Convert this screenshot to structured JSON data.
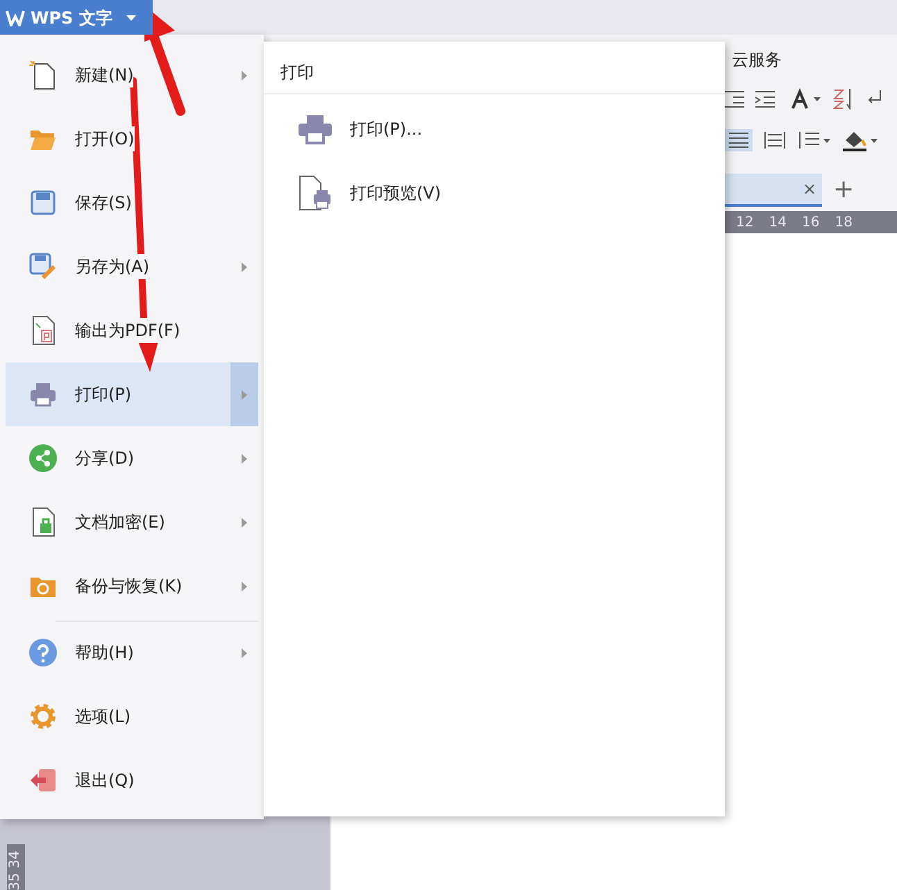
{
  "app_button": {
    "label": "WPS 文字"
  },
  "ribbon": {
    "tab": "云服务"
  },
  "document_tab": {
    "close": "×"
  },
  "new_tab": "+",
  "ruler": {
    "marks": [
      "12",
      "14",
      "16",
      "18"
    ]
  },
  "vertical_ruler": {
    "marks": [
      "34",
      "35"
    ]
  },
  "menu": {
    "items": [
      {
        "label": "新建(N)",
        "submenu": true,
        "selected": false,
        "separator_before": false
      },
      {
        "label": "打开(O)",
        "submenu": false,
        "selected": false,
        "separator_before": false
      },
      {
        "label": "保存(S)",
        "submenu": false,
        "selected": false,
        "separator_before": false
      },
      {
        "label": "另存为(A)",
        "submenu": true,
        "selected": false,
        "separator_before": false
      },
      {
        "label": "输出为PDF(F)",
        "submenu": false,
        "selected": false,
        "separator_before": false
      },
      {
        "label": "打印(P)",
        "submenu": true,
        "selected": true,
        "separator_before": false
      },
      {
        "label": "分享(D)",
        "submenu": true,
        "selected": false,
        "separator_before": false
      },
      {
        "label": "文档加密(E)",
        "submenu": true,
        "selected": false,
        "separator_before": false
      },
      {
        "label": "备份与恢复(K)",
        "submenu": true,
        "selected": false,
        "separator_before": false
      },
      {
        "label": "帮助(H)",
        "submenu": true,
        "selected": false,
        "separator_before": true
      },
      {
        "label": "选项(L)",
        "submenu": false,
        "selected": false,
        "separator_before": false
      },
      {
        "label": "退出(Q)",
        "submenu": false,
        "selected": false,
        "separator_before": false
      }
    ]
  },
  "submenu": {
    "title": "打印",
    "items": [
      {
        "label": "打印(P)..."
      },
      {
        "label": "打印预览(V)"
      }
    ]
  }
}
